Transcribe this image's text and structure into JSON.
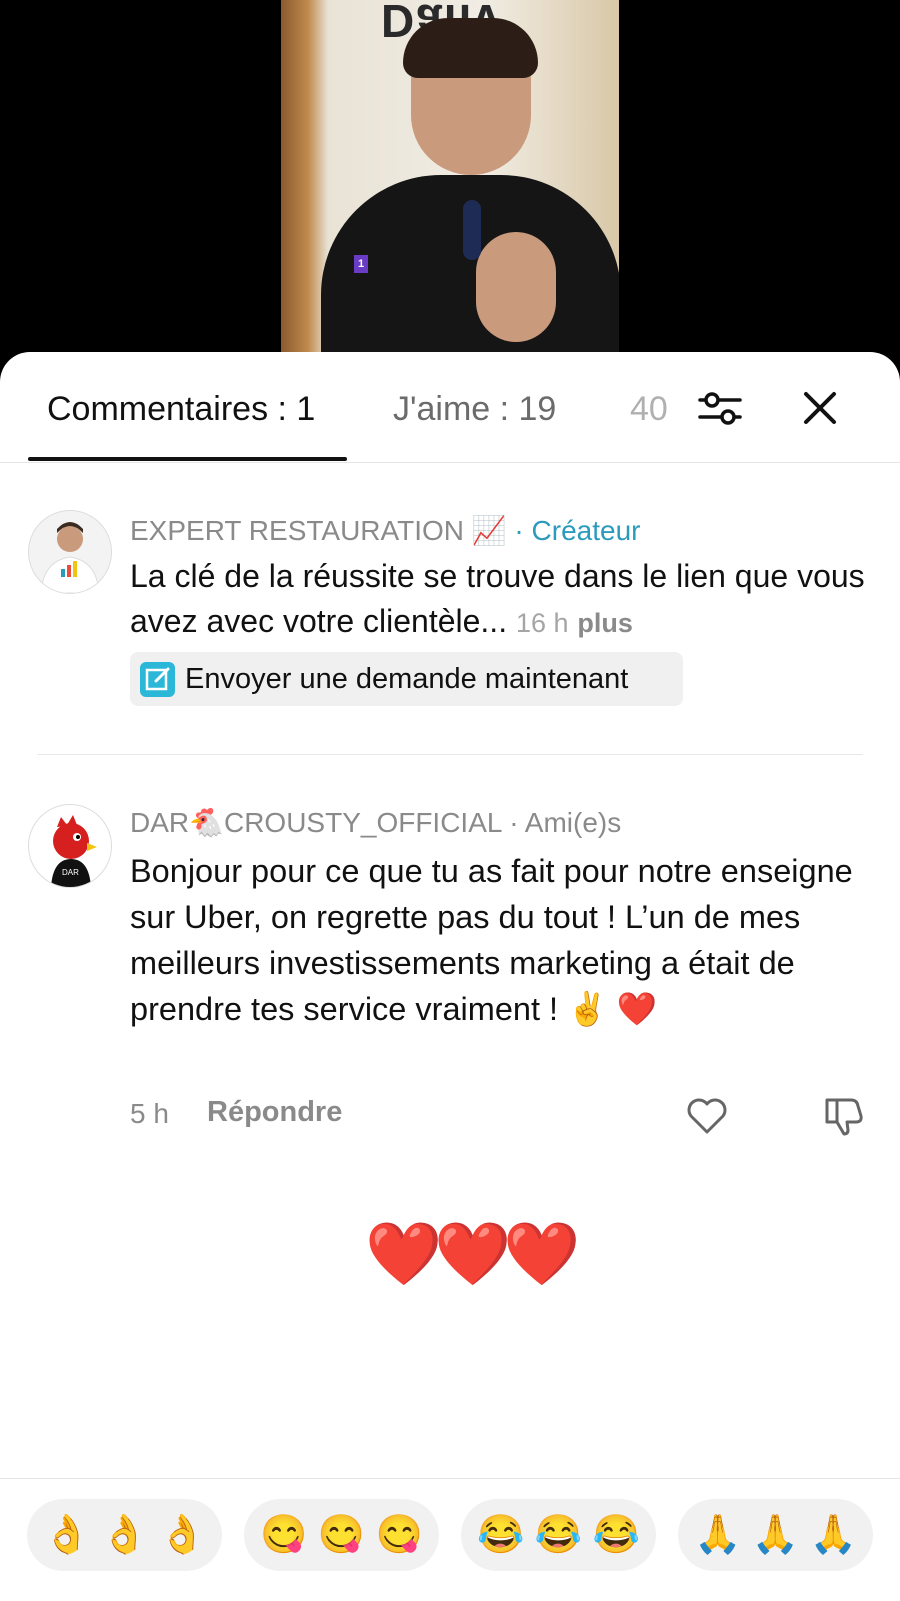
{
  "video": {
    "badge": "1",
    "wall_logo": "Dailv"
  },
  "tabs": {
    "comments": "Commentaires : 1",
    "likes": "J'aime : 19",
    "third": "40"
  },
  "comments": [
    {
      "author": "EXPERT RESTAURATION 📈",
      "role": "· Créateur",
      "text": "La clé de la réussite se trouve dans le lien que vous avez avec votre clientèle...",
      "time": "16 h",
      "more": "plus",
      "cta": "Envoyer une demande maintenant"
    },
    {
      "author": "DAR🐔CROUSTY_OFFICIAL",
      "role": "· Ami(e)s",
      "text": "Bonjour pour ce que tu as fait pour notre enseigne sur Uber, on regrette pas du tout ! L’un de mes meilleurs investissements marketing a était de prendre tes service vraiment ! ✌️ ❤️",
      "time": "5 h",
      "reply": "Répondre"
    }
  ],
  "hearts": "❤️❤️❤️",
  "quick_emojis": [
    "👌 👌 👌",
    "😋 😋 😋",
    "😂 😂 😂",
    "🙏 🙏 🙏"
  ],
  "icons": {
    "filter": "sliders-icon",
    "close": "close-icon",
    "like": "heart-outline-icon",
    "dislike": "thumbs-down-icon"
  },
  "colors": {
    "creator": "#2b9bbd",
    "badge": "#6a3cc6",
    "cta_icon": "#2bb7d8"
  }
}
